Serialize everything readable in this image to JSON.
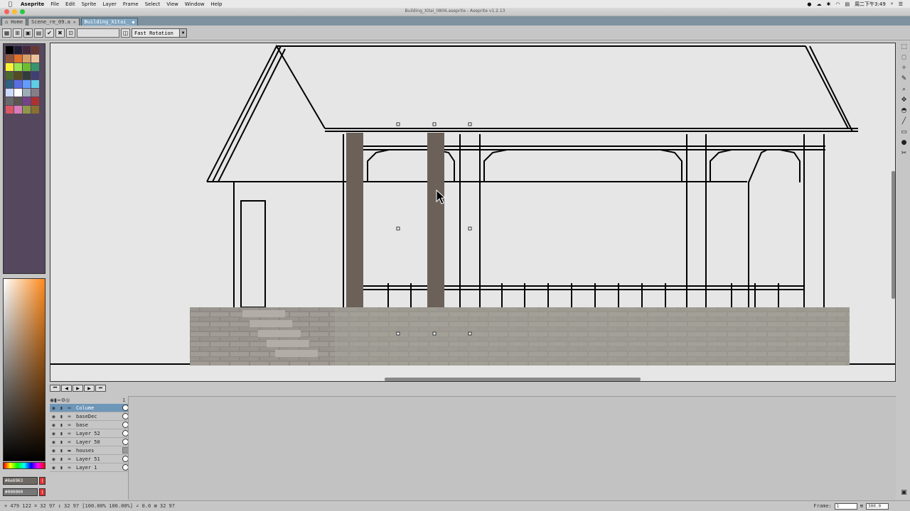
{
  "menubar": {
    "app": "Aseprite",
    "items": [
      "File",
      "Edit",
      "Sprite",
      "Layer",
      "Frame",
      "Select",
      "View",
      "Window",
      "Help"
    ],
    "clock": "周二下午3:49"
  },
  "window": {
    "title": "Building_Xitai_0806.aseprite - Aseprite v1.2.13"
  },
  "tabs": [
    {
      "label": "Home",
      "active": false
    },
    {
      "label": "Scene_re_09.a",
      "active": false
    },
    {
      "label": "Building_Xitai_",
      "active": true
    }
  ],
  "context_bar": {
    "rotation_algorithm": "Fast Rotation"
  },
  "palette": {
    "colors": [
      "#000000",
      "#222034",
      "#45283c",
      "#663931",
      "#8f563b",
      "#df7126",
      "#d9a066",
      "#eec39a",
      "#fbf236",
      "#99e550",
      "#6abe30",
      "#37946e",
      "#4b692f",
      "#524b24",
      "#323c39",
      "#3f3f74",
      "#306082",
      "#5b6ee1",
      "#639bff",
      "#5fcde4",
      "#cbdbfc",
      "#ffffff",
      "#9badb7",
      "#847e87",
      "#696a6a",
      "#595652",
      "#76428a",
      "#ac3232",
      "#d95763",
      "#d77bba",
      "#8f974a",
      "#8a6f30"
    ],
    "picker_hue": "#ff8a1c"
  },
  "colors": {
    "foreground_hex": "#6e6963",
    "background_hex": "#000000",
    "pillar": "#6b6158",
    "canvas_bg": "#e6e6e6",
    "selection": "#6e96b8"
  },
  "timeline": {
    "layers": [
      {
        "name": "Colume",
        "selected": true,
        "type": "layer"
      },
      {
        "name": "baseDec",
        "selected": false,
        "type": "layer"
      },
      {
        "name": "base",
        "selected": false,
        "type": "layer"
      },
      {
        "name": "Layer 52",
        "selected": false,
        "type": "layer"
      },
      {
        "name": "Layer 50",
        "selected": false,
        "type": "layer"
      },
      {
        "name": "houses",
        "selected": false,
        "type": "group"
      },
      {
        "name": "Layer 51",
        "selected": false,
        "type": "layer"
      },
      {
        "name": "Layer 1",
        "selected": false,
        "type": "layer"
      }
    ],
    "frame_header": "1"
  },
  "statusbar": {
    "info": "+ 479 122  ⌗ 32 97  ↕ 32 97 [100.00% 100.00%] ∠ 0.0  ⊠ 32 97",
    "frame_label": "Frame:",
    "frame_value": "1",
    "zoom": "300.0"
  }
}
